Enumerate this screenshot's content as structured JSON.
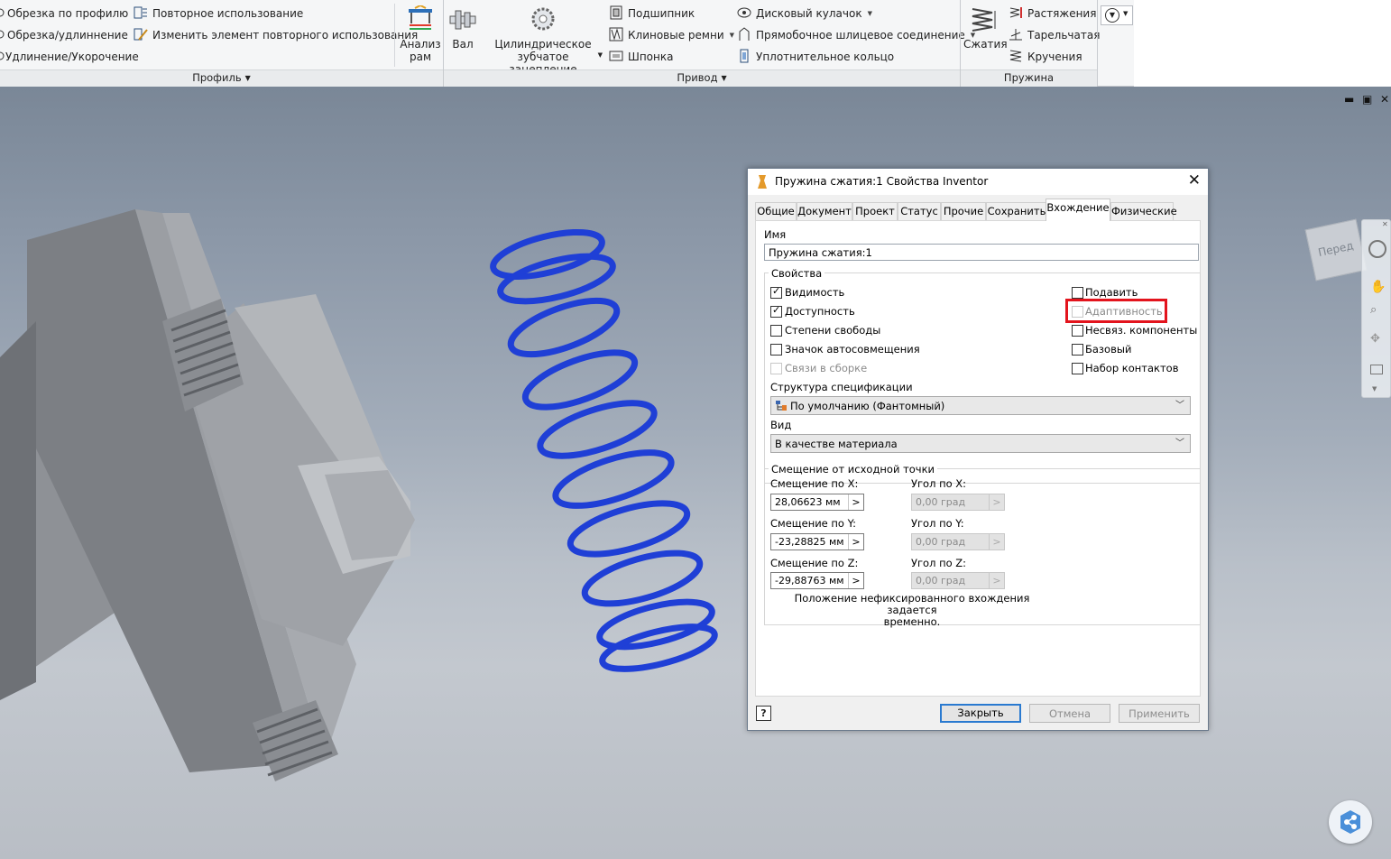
{
  "ribbon": {
    "profile": {
      "items": [
        "Обрезка по профилю",
        "Обрезка/удлиннение",
        "Удлинение/Укорочение"
      ],
      "reuse_items": [
        "Повторное использование",
        "Изменить элемент повторного использования"
      ],
      "frame_analysis": [
        "Анализ",
        "рам"
      ],
      "panel_label": "Профиль"
    },
    "drive": {
      "shaft": "Вал",
      "gear": [
        "Цилиндрическое",
        "зубчатое зацепление"
      ],
      "col1": [
        "Подшипник",
        "Клиновые ремни",
        "Шпонка"
      ],
      "col2": [
        "Дисковый кулачок",
        "Прямобочное шлицевое соединение",
        "Уплотнительное кольцо"
      ],
      "panel_label": "Привод"
    },
    "spring": {
      "compression": "Сжатия",
      "items": [
        "Растяжения",
        "Тарельчатая",
        "Кручения"
      ],
      "panel_label": "Пружина"
    }
  },
  "viewcube_label": "Перед",
  "dialog": {
    "title": "Пружина сжатия:1 Свойства Inventor",
    "tabs": [
      "Общие",
      "Документ",
      "Проект",
      "Статус",
      "Прочие",
      "Сохранить",
      "Вхождение",
      "Физические"
    ],
    "active_tab": "Вхождение",
    "name_label": "Имя",
    "name_value": "Пружина сжатия:1",
    "properties_label": "Свойства",
    "left_checks": [
      {
        "label": "Видимость",
        "checked": true,
        "disabled": false
      },
      {
        "label": "Доступность",
        "checked": true,
        "disabled": false
      },
      {
        "label": "Степени свободы",
        "checked": false,
        "disabled": false
      },
      {
        "label": "Значок автосовмещения",
        "checked": false,
        "disabled": false
      },
      {
        "label": "Связи в сборке",
        "checked": false,
        "disabled": true
      }
    ],
    "right_checks": [
      {
        "label": "Подавить",
        "checked": false,
        "disabled": false
      },
      {
        "label": "Адаптивность",
        "checked": false,
        "disabled": true
      },
      {
        "label": "Несвяз. компоненты",
        "checked": false,
        "disabled": false
      },
      {
        "label": "Базовый",
        "checked": false,
        "disabled": false
      },
      {
        "label": "Набор контактов",
        "checked": false,
        "disabled": false
      }
    ],
    "bom_label": "Структура спецификации",
    "bom_value": "По умолчанию (Фантомный)",
    "view_label": "Вид",
    "view_value": "В качестве материала",
    "offset_group_label": "Смещение от исходной точки",
    "offset_x_label": "Смещение по X:",
    "offset_x_value": "28,06623 мм",
    "offset_y_label": "Смещение по Y:",
    "offset_y_value": "-23,28825 мм",
    "offset_z_label": "Смещение по Z:",
    "offset_z_value": "-29,88763 мм",
    "angle_x_label": "Угол по X:",
    "angle_y_label": "Угол по Y:",
    "angle_z_label": "Угол по Z:",
    "angle_value": "0,00 град",
    "note_line1": "Положение нефиксированного вхождения задается",
    "note_line2": "временно.",
    "help_label": "?",
    "close_button": "Закрыть",
    "cancel_button": "Отмена",
    "apply_button": "Применить"
  },
  "colors": {
    "spring": "#1f3fd6",
    "highlight": "#e3141d",
    "primary_border": "#2a7ad0"
  }
}
